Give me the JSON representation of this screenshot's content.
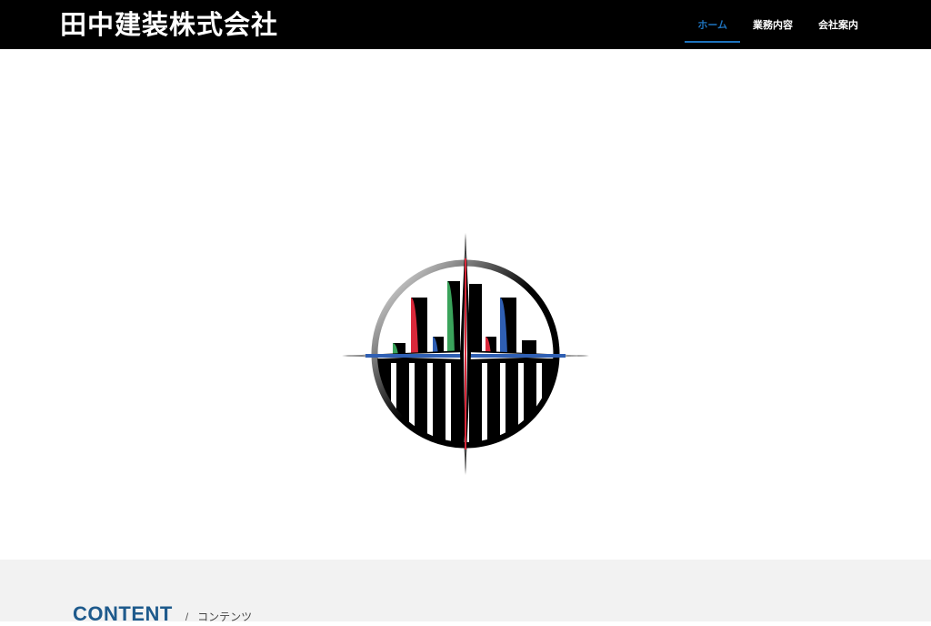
{
  "header": {
    "site_title": "田中建装株式会社"
  },
  "nav": {
    "items": [
      {
        "label": "ホーム",
        "active": true
      },
      {
        "label": "業務内容",
        "active": false
      },
      {
        "label": "会社案内",
        "active": false
      }
    ]
  },
  "hero": {
    "logo": "company-emblem-logo"
  },
  "section": {
    "title": "CONTENT",
    "separator": "/",
    "subtitle": "コンテンツ"
  },
  "colors": {
    "header_bg": "#000000",
    "nav_active": "#1e73be",
    "section_title": "#1e5a8c",
    "section_bg": "#f2f2f2",
    "logo_red": "#d9283a",
    "logo_green": "#3aa35b",
    "logo_blue": "#2f5fb3"
  }
}
